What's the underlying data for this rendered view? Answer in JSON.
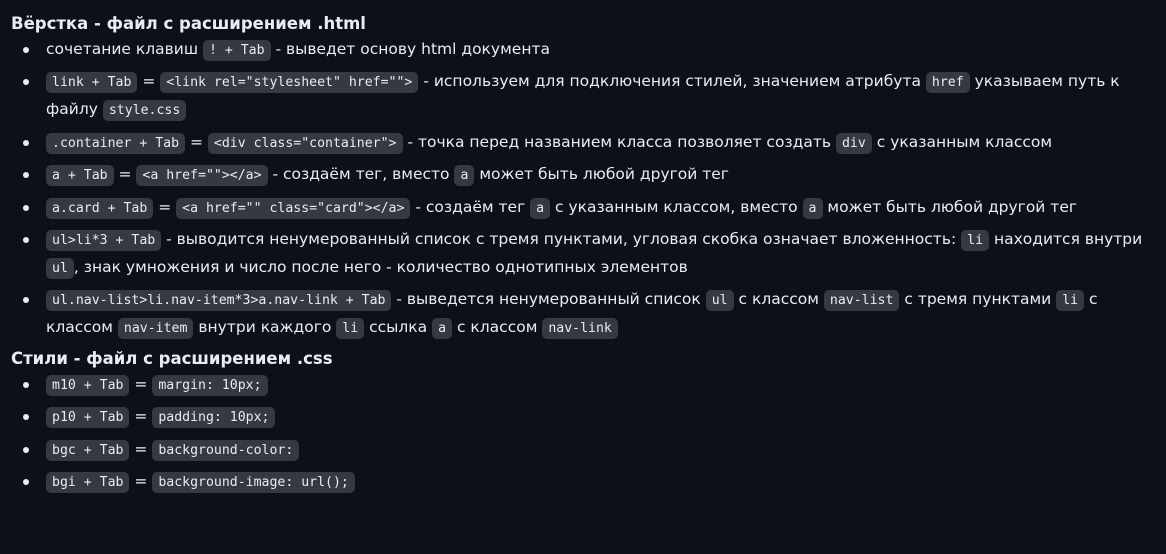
{
  "sections": [
    {
      "title": "Вёрстка - файл с расширением .html",
      "items": [
        [
          {
            "t": "text",
            "v": "сочетание клавиш "
          },
          {
            "t": "code",
            "v": "! + Tab"
          },
          {
            "t": "text",
            "v": " - выведет основу html документа"
          }
        ],
        [
          {
            "t": "code",
            "v": "link + Tab"
          },
          {
            "t": "text",
            "v": " = "
          },
          {
            "t": "code",
            "v": "<link rel=\"stylesheet\" href=\"\">"
          },
          {
            "t": "text",
            "v": " - используем для подключения стилей, значением атрибута "
          },
          {
            "t": "code",
            "v": "href"
          },
          {
            "t": "text",
            "v": " указываем путь к файлу "
          },
          {
            "t": "code",
            "v": "style.css"
          }
        ],
        [
          {
            "t": "code",
            "v": ".container + Tab"
          },
          {
            "t": "text",
            "v": " = "
          },
          {
            "t": "code",
            "v": "<div class=\"container\">"
          },
          {
            "t": "text",
            "v": " - точка перед названием класса позволяет создать "
          },
          {
            "t": "code",
            "v": "div"
          },
          {
            "t": "text",
            "v": " с указанным классом"
          }
        ],
        [
          {
            "t": "code",
            "v": "a + Tab"
          },
          {
            "t": "text",
            "v": " = "
          },
          {
            "t": "code",
            "v": "<a href=\"\"></a>"
          },
          {
            "t": "text",
            "v": " - создаём тег, вместо "
          },
          {
            "t": "code",
            "v": "a"
          },
          {
            "t": "text",
            "v": " может быть любой другой тег"
          }
        ],
        [
          {
            "t": "code",
            "v": "a.card + Tab"
          },
          {
            "t": "text",
            "v": " = "
          },
          {
            "t": "code",
            "v": "<a href=\"\" class=\"card\"></a>"
          },
          {
            "t": "text",
            "v": " - создаём тег "
          },
          {
            "t": "code",
            "v": "a"
          },
          {
            "t": "text",
            "v": " с указанным классом, вместо "
          },
          {
            "t": "code",
            "v": "a"
          },
          {
            "t": "text",
            "v": " может быть любой другой тег"
          }
        ],
        [
          {
            "t": "code",
            "v": "ul>li*3 + Tab"
          },
          {
            "t": "text",
            "v": " - выводится ненумерованный список с тремя пунктами, угловая скобка означает вложенность: "
          },
          {
            "t": "code",
            "v": "li"
          },
          {
            "t": "text",
            "v": " находится внутри "
          },
          {
            "t": "code",
            "v": "ul"
          },
          {
            "t": "text",
            "v": ", знак умножения и число после него - количество однотипных элементов"
          }
        ],
        [
          {
            "t": "code",
            "v": "ul.nav-list>li.nav-item*3>a.nav-link + Tab"
          },
          {
            "t": "text",
            "v": " - выведется ненумерованный список "
          },
          {
            "t": "code",
            "v": "ul"
          },
          {
            "t": "text",
            "v": " с классом "
          },
          {
            "t": "code",
            "v": "nav-list"
          },
          {
            "t": "text",
            "v": " с тремя пунктами "
          },
          {
            "t": "code",
            "v": "li"
          },
          {
            "t": "text",
            "v": " с классом "
          },
          {
            "t": "code",
            "v": "nav-item"
          },
          {
            "t": "text",
            "v": " внутри каждого "
          },
          {
            "t": "code",
            "v": "li"
          },
          {
            "t": "text",
            "v": " ссылка "
          },
          {
            "t": "code",
            "v": "a"
          },
          {
            "t": "text",
            "v": " с классом "
          },
          {
            "t": "code",
            "v": "nav-link"
          }
        ]
      ]
    },
    {
      "title": "Стили - файл с расширением .css",
      "items": [
        [
          {
            "t": "code",
            "v": "m10 + Tab"
          },
          {
            "t": "text",
            "v": " = "
          },
          {
            "t": "code",
            "v": "margin: 10px;"
          }
        ],
        [
          {
            "t": "code",
            "v": "p10 + Tab"
          },
          {
            "t": "text",
            "v": " = "
          },
          {
            "t": "code",
            "v": "padding: 10px;"
          }
        ],
        [
          {
            "t": "code",
            "v": "bgc + Tab"
          },
          {
            "t": "text",
            "v": " = "
          },
          {
            "t": "code",
            "v": "background-color:"
          }
        ],
        [
          {
            "t": "code",
            "v": "bgi + Tab"
          },
          {
            "t": "text",
            "v": " = "
          },
          {
            "t": "code",
            "v": "background-image: url();"
          }
        ]
      ]
    }
  ]
}
